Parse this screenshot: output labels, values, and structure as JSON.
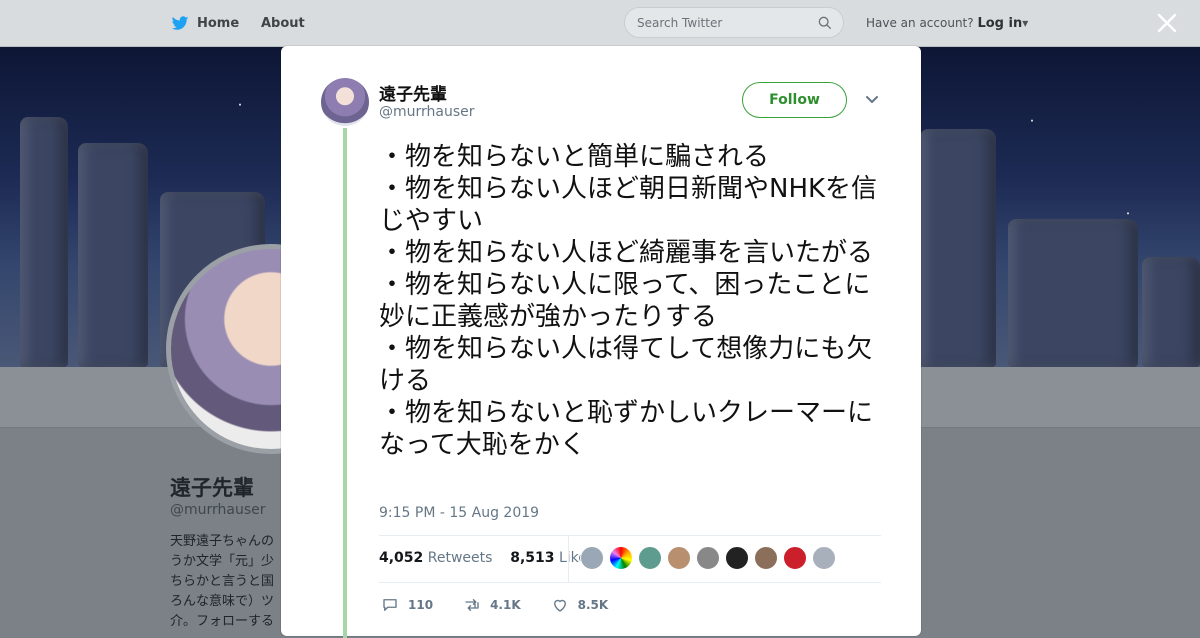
{
  "topbar": {
    "home_label": "Home",
    "about_label": "About",
    "search_placeholder": "Search Twitter",
    "account_prompt": "Have an account?",
    "login_label": "Log in"
  },
  "profile": {
    "name": "遠子先輩",
    "handle": "@murrhauser",
    "bio": "天野遠子ちゃんの\nうか文学「元」少\nちらかと言うと国\nろんな意味で）ツ\n介。フォローする"
  },
  "tweet": {
    "name": "遠子先輩",
    "handle": "@murrhauser",
    "follow_label": "Follow",
    "text": "・物を知らないと簡単に騙される\n・物を知らない人ほど朝日新聞やNHKを信じやすい\n・物を知らない人ほど綺麗事を言いたがる\n・物を知らない人に限って、困ったことに妙に正義感が強かったりする\n・物を知らない人は得てして想像力にも欠ける\n・物を知らないと恥ずかしいクレーマーになって大恥をかく",
    "timestamp": "9:15 PM - 15 Aug 2019",
    "retweets_count": "4,052",
    "retweets_label": "Retweets",
    "likes_count": "8,513",
    "likes_label": "Likes",
    "reply_count": "110",
    "retweet_count_short": "4.1K",
    "like_count_short": "8.5K"
  },
  "colors": {
    "follow_green": "#2e8f2e",
    "thread_line": "#a5d6a7",
    "link_gray": "#657786"
  },
  "icons": {
    "logo": "twitter-bird-icon",
    "search": "search-icon",
    "close": "close-icon",
    "chevron": "chevron-down-icon",
    "reply": "reply-icon",
    "retweet": "retweet-icon",
    "like": "heart-icon"
  }
}
